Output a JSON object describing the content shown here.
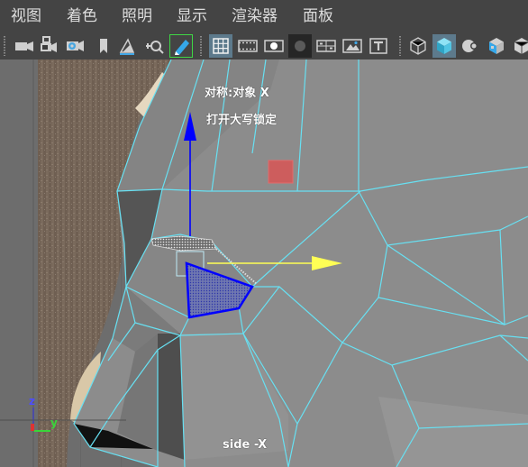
{
  "menu": [
    "视图",
    "着色",
    "照明",
    "显示",
    "渲染器",
    "面板"
  ],
  "toolbar": {
    "left_tools": [
      "camera-icon",
      "camera-lock-icon",
      "camera-attributes-icon",
      "bookmark-icon",
      "image-plane-icon",
      "track-geometry-icon",
      "grease-pencil-icon"
    ],
    "display_tools": [
      "grid-icon",
      "film-gate-icon",
      "resolution-gate-icon",
      "gate-mask-icon",
      "field-chart-icon",
      "safe-action-icon",
      "safe-title-icon"
    ],
    "shading_tools": [
      "wireframe-icon",
      "smooth-shade-icon",
      "default-material-icon",
      "textured-icon"
    ],
    "active_tools": [
      "grid-icon",
      "smooth-shade-icon"
    ],
    "accent_color": "#3fd645",
    "active_color": "#5d7a8c"
  },
  "viewport": {
    "hud_symmetry": "对称:对象 X",
    "hud_caps_lock": "打开大写锁定",
    "camera_label": "side -X",
    "axis_labels": {
      "z": "z",
      "y": "y"
    },
    "wire_color": "#67e0f2",
    "selection_color": "#0000ff",
    "manip_y_color": "#0000ff",
    "manip_z_color": "#ffff55",
    "manip_center_color": "#ee4444"
  }
}
